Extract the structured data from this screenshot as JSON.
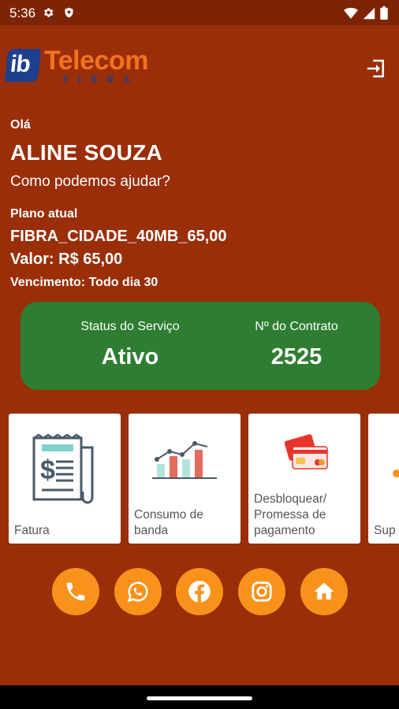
{
  "status_bar": {
    "time": "5:36"
  },
  "brand": {
    "ib": "ib",
    "name": "Telecom",
    "sub": "FIBRA"
  },
  "greeting": {
    "hello": "Olá",
    "name": "ALINE SOUZA",
    "prompt": "Como podemos ajudar?"
  },
  "plan": {
    "label": "Plano atual",
    "name": "FIBRA_CIDADE_40MB_65,00",
    "price": "Valor: R$ 65,00",
    "due": "Vencimento: Todo dia 30"
  },
  "status_card": {
    "status_label": "Status do Serviço",
    "status_value": "Ativo",
    "contract_label": "Nº do Contrato",
    "contract_value": "2525",
    "color": "#2E7D32"
  },
  "services": [
    {
      "label": "Fatura",
      "icon": "invoice-icon"
    },
    {
      "label": "Consumo de\nbanda",
      "icon": "bandwidth-chart-icon"
    },
    {
      "label": "Desbloquear/\nPromessa de\npagamento",
      "icon": "credit-card-icon"
    },
    {
      "label": "Sup",
      "icon": "support-icon"
    }
  ],
  "social": [
    {
      "icon": "phone-icon"
    },
    {
      "icon": "whatsapp-icon"
    },
    {
      "icon": "facebook-icon"
    },
    {
      "icon": "instagram-icon"
    },
    {
      "icon": "home-icon"
    }
  ],
  "colors": {
    "background": "#9A2E09",
    "accent": "#F9921B",
    "brand_orange": "#F4721F",
    "brand_blue": "#1D3F8C"
  }
}
